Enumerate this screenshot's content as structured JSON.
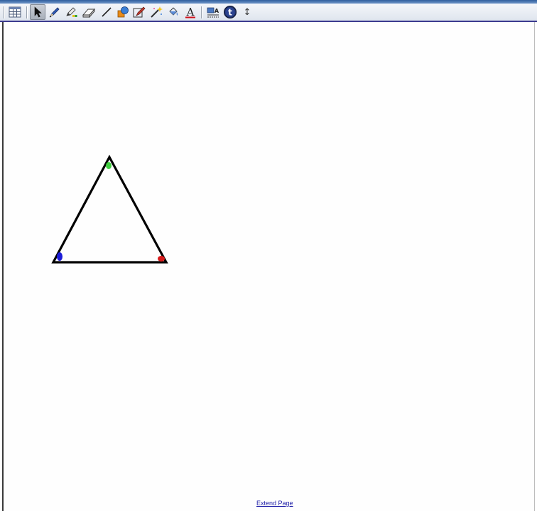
{
  "toolbar": {
    "tools": [
      {
        "name": "grid-icon",
        "selected": false
      },
      {
        "name": "select-arrow-icon",
        "selected": true
      },
      {
        "name": "pen-icon",
        "selected": false
      },
      {
        "name": "highlighter-icon",
        "selected": false
      },
      {
        "name": "eraser-icon",
        "selected": false
      },
      {
        "name": "line-icon",
        "selected": false
      },
      {
        "name": "shapes-icon",
        "selected": false
      },
      {
        "name": "shape-recognition-pen-icon",
        "selected": false
      },
      {
        "name": "magic-pen-icon",
        "selected": false
      },
      {
        "name": "fill-icon",
        "selected": false
      },
      {
        "name": "text-icon",
        "selected": false
      },
      {
        "name": "properties-icon",
        "selected": false
      },
      {
        "name": "info-icon",
        "selected": false
      },
      {
        "name": "resize-icon",
        "selected": false
      }
    ],
    "text_tool_label": "A",
    "info_tool_label": "t",
    "resize_tool_label": "↕"
  },
  "colors": {
    "triangle_stroke": "#000000",
    "top_vertex": "#3fcf3f",
    "left_vertex": "#1c1cd8",
    "right_vertex": "#d81c1c",
    "toolbar_border": "#3b3b8f",
    "link": "#1a1aa6"
  },
  "footer": {
    "extend_page_label": "Extend Page"
  }
}
